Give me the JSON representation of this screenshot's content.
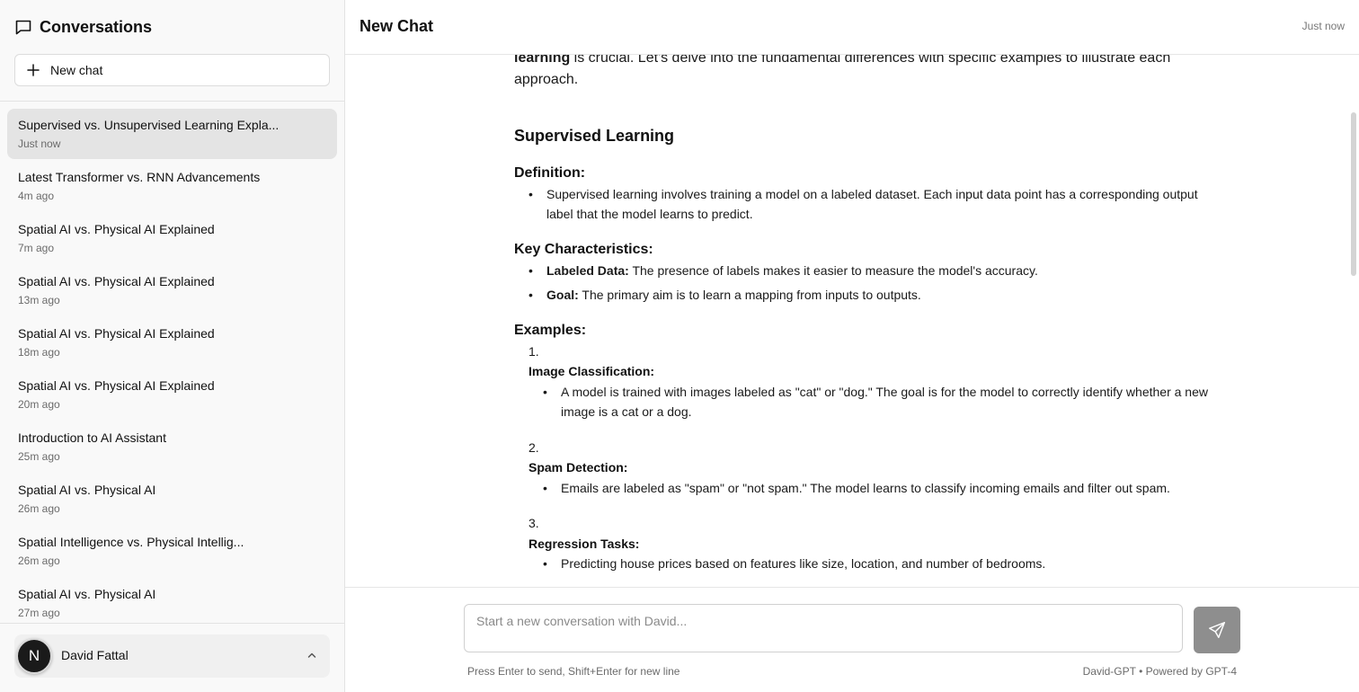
{
  "sidebar": {
    "title": "Conversations",
    "new_chat_label": "New chat",
    "conversations": [
      {
        "title": "Supervised vs. Unsupervised Learning Expla...",
        "time": "Just now"
      },
      {
        "title": "Latest Transformer vs. RNN Advancements",
        "time": "4m ago"
      },
      {
        "title": "Spatial AI vs. Physical AI Explained",
        "time": "7m ago"
      },
      {
        "title": "Spatial AI vs. Physical AI Explained",
        "time": "13m ago"
      },
      {
        "title": "Spatial AI vs. Physical AI Explained",
        "time": "18m ago"
      },
      {
        "title": "Spatial AI vs. Physical AI Explained",
        "time": "20m ago"
      },
      {
        "title": "Introduction to AI Assistant",
        "time": "25m ago"
      },
      {
        "title": "Spatial AI vs. Physical AI",
        "time": "26m ago"
      },
      {
        "title": "Spatial Intelligence vs. Physical Intellig...",
        "time": "26m ago"
      },
      {
        "title": "Spatial AI vs. Physical AI",
        "time": "27m ago"
      }
    ],
    "user": {
      "initial": "N",
      "name": "David Fattal"
    }
  },
  "header": {
    "title": "New Chat",
    "time": "Just now"
  },
  "message": {
    "intro_bold": "learning",
    "intro_rest": " is crucial. Let's delve into the fundamental differences with specific examples to illustrate each approach.",
    "section_title": "Supervised Learning",
    "definition_heading": "Definition:",
    "definition_text": "Supervised learning involves training a model on a labeled dataset. Each input data point has a corresponding output label that the model learns to predict.",
    "characteristics_heading": "Key Characteristics:",
    "characteristics": [
      {
        "label": "Labeled Data:",
        "text": " The presence of labels makes it easier to measure the model's accuracy."
      },
      {
        "label": "Goal:",
        "text": " The primary aim is to learn a mapping from inputs to outputs."
      }
    ],
    "examples_heading": "Examples:",
    "examples": [
      {
        "num": "1.",
        "title": "Image Classification:",
        "text": "A model is trained with images labeled as \"cat\" or \"dog.\" The goal is for the model to correctly identify whether a new image is a cat or a dog."
      },
      {
        "num": "2.",
        "title": "Spam Detection:",
        "text": "Emails are labeled as \"spam\" or \"not spam.\" The model learns to classify incoming emails and filter out spam."
      },
      {
        "num": "3.",
        "title": "Regression Tasks:",
        "text": "Predicting house prices based on features like size, location, and number of bedrooms."
      }
    ]
  },
  "composer": {
    "placeholder": "Start a new conversation with David...",
    "hint": "Press Enter to send, Shift+Enter for new line",
    "powered_by": "David-GPT • Powered by GPT-4"
  }
}
